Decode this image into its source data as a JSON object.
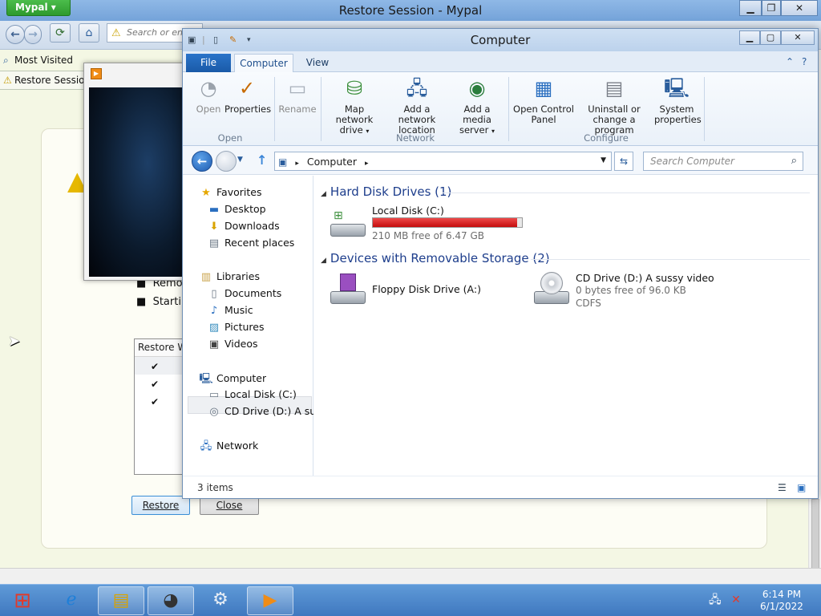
{
  "browser": {
    "app_menu": "Mypal",
    "title": "Restore Session - Mypal",
    "url_placeholder": "Search or enter address",
    "bookmarks": {
      "most_visited": "Most Visited",
      "restore_session": "Restore Session"
    },
    "page": {
      "bullet_1": "Removi",
      "bullet_2": "Starting",
      "table_header": "Restore   W",
      "restore_button": "Restore",
      "close_button": "Close"
    }
  },
  "explorer": {
    "title": "Computer",
    "tabs": {
      "file": "File",
      "computer": "Computer",
      "view": "View"
    },
    "ribbon": {
      "open": "Open",
      "properties": "Properties",
      "rename": "Rename",
      "group_open": "Open",
      "map_network_drive_1": "Map network",
      "map_network_drive_2": "drive",
      "add_network_location_1": "Add a network",
      "add_network_location_2": "location",
      "add_media_server_1": "Add a media",
      "add_media_server_2": "server",
      "group_network": "Network",
      "open_control_panel_1": "Open Control",
      "open_control_panel_2": "Panel",
      "uninstall_1": "Uninstall or",
      "uninstall_2": "change a program",
      "system_properties_1": "System",
      "system_properties_2": "properties",
      "group_configure": "Configure"
    },
    "address": {
      "location": "Computer",
      "search_placeholder": "Search Computer"
    },
    "nav": {
      "favorites": "Favorites",
      "desktop": "Desktop",
      "downloads": "Downloads",
      "recent_places": "Recent places",
      "libraries": "Libraries",
      "documents": "Documents",
      "music": "Music",
      "pictures": "Pictures",
      "videos": "Videos",
      "computer": "Computer",
      "local_disk": "Local Disk (C:)",
      "cd_drive": "CD Drive (D:) A sussy video",
      "network": "Network"
    },
    "sections": {
      "hard_disks": "Hard Disk Drives (1)",
      "removable": "Devices with Removable Storage (2)"
    },
    "drives": {
      "local_disk": {
        "name": "Local Disk (C:)",
        "free": "210 MB free of 6.47 GB",
        "used_fraction": 0.968
      },
      "floppy": {
        "name": "Floppy Disk Drive (A:)"
      },
      "cd": {
        "name": "CD Drive (D:) A sussy video",
        "free": "0 bytes free of 96.0 KB",
        "fs": "CDFS"
      }
    },
    "status": {
      "items": "3 items"
    }
  },
  "taskbar": {
    "time": "6:14 PM",
    "date": "6/1/2022"
  }
}
